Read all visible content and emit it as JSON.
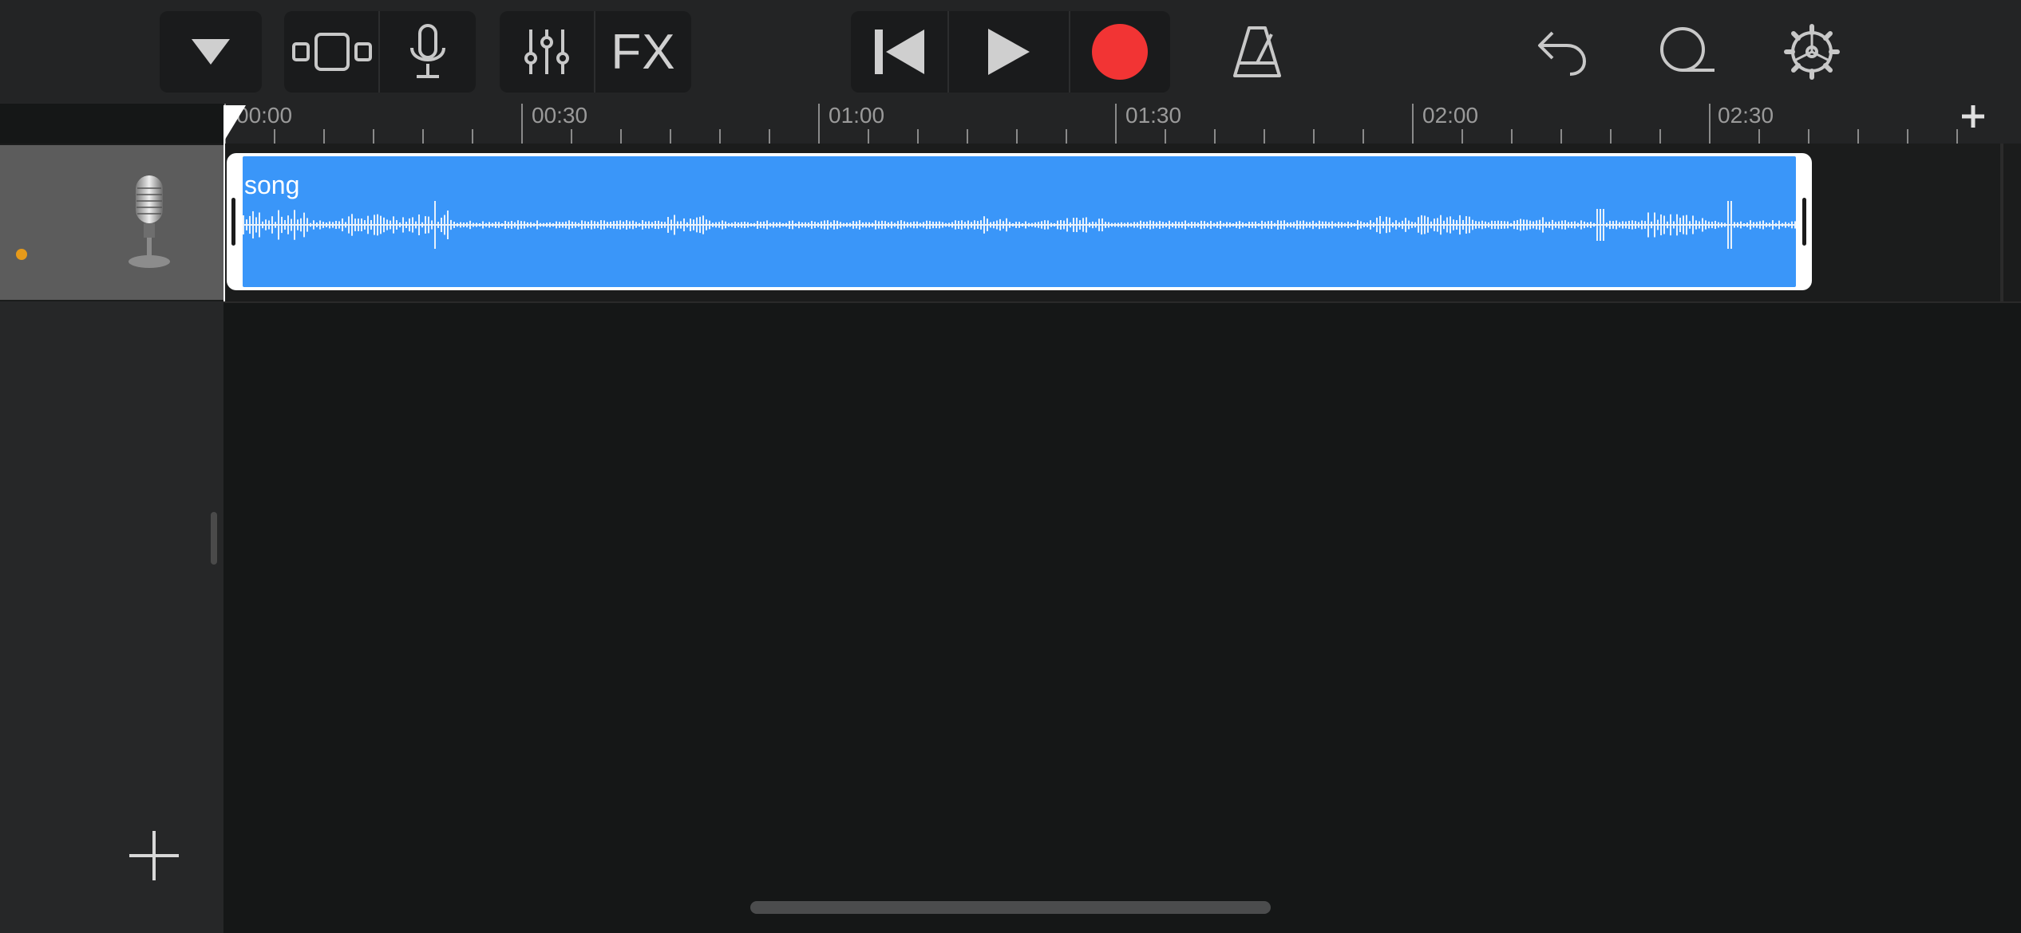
{
  "toolbar": {
    "browser_icon": "triangle-down-icon",
    "track_view_icon": "track-view-icon",
    "instrument_icon": "microphone-icon",
    "mixer_icon": "sliders-icon",
    "fx_label": "FX",
    "go_to_beginning_icon": "skip-back-icon",
    "play_icon": "play-icon",
    "record_icon": "record-icon",
    "metronome_icon": "metronome-icon",
    "undo_icon": "undo-icon",
    "loop_icon": "loop-icon",
    "settings_icon": "gear-icon",
    "record_color": "#f23434"
  },
  "ruler": {
    "labels": [
      "00:00",
      "00:30",
      "01:00",
      "01:30",
      "02:00",
      "02:30"
    ],
    "add_icon": "plus-icon"
  },
  "track": {
    "instrument": "microphone",
    "indicator_color": "#e69a1a",
    "region": {
      "title": "song",
      "color": "#3a96f9"
    }
  },
  "sidebar": {
    "add_track_icon": "plus-icon"
  }
}
